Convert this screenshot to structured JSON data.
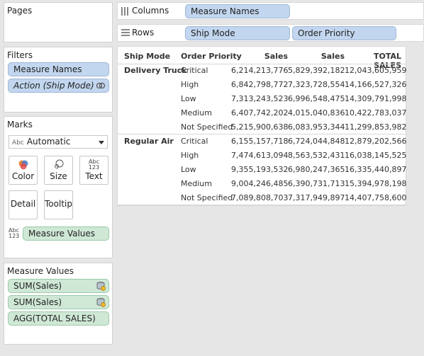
{
  "pages": {
    "title": "Pages"
  },
  "filters": {
    "title": "Filters",
    "items": [
      "Measure Names",
      "Action (Ship Mode)"
    ]
  },
  "marks": {
    "title": "Marks",
    "type_prefix": "Abc",
    "type_value": "Automatic",
    "buttons": {
      "color": "Color",
      "size": "Size",
      "text": "Text",
      "detail": "Detail",
      "tooltip": "Tooltip"
    },
    "text_icon_top": "Abc",
    "text_icon_bottom": "123",
    "measure_pill": "Measure Values"
  },
  "measure_values": {
    "title": "Measure Values",
    "items": [
      "SUM(Sales)",
      "SUM(Sales)",
      "AGG(TOTAL SALES)"
    ]
  },
  "columns_shelf": {
    "label": "Columns",
    "pills": [
      "Measure Names"
    ]
  },
  "rows_shelf": {
    "label": "Rows",
    "pills": [
      "Ship Mode",
      "Order Priority"
    ]
  },
  "table": {
    "headers": [
      "Ship Mode",
      "Order Priority",
      "Sales",
      "Sales",
      "TOTAL SALES"
    ],
    "groups": [
      {
        "ship_mode": "Delivery Truck",
        "rows": [
          {
            "priority": "Critical",
            "sales1": "6,214,213,776",
            "sales2": "5,829,392,182",
            "total": "12,043,605,959"
          },
          {
            "priority": "High",
            "sales1": "6,842,798,772",
            "sales2": "7,323,728,554",
            "total": "14,166,527,326"
          },
          {
            "priority": "Low",
            "sales1": "7,313,243,523",
            "sales2": "6,996,548,475",
            "total": "14,309,791,998"
          },
          {
            "priority": "Medium",
            "sales1": "6,407,742,202",
            "sales2": "4,015,040,836",
            "total": "10,422,783,037"
          },
          {
            "priority": "Not Specified",
            "sales1": "5,215,900,638",
            "sales2": "6,083,953,344",
            "total": "11,299,853,982"
          }
        ]
      },
      {
        "ship_mode": "Regular Air",
        "rows": [
          {
            "priority": "Critical",
            "sales1": "6,155,157,718",
            "sales2": "6,724,044,848",
            "total": "12,879,202,566"
          },
          {
            "priority": "High",
            "sales1": "7,474,613,094",
            "sales2": "8,563,532,431",
            "total": "16,038,145,525"
          },
          {
            "priority": "Low",
            "sales1": "9,355,193,532",
            "sales2": "6,980,247,365",
            "total": "16,335,440,897"
          },
          {
            "priority": "Medium",
            "sales1": "9,004,246,485",
            "sales2": "6,390,731,713",
            "total": "15,394,978,198"
          },
          {
            "priority": "Not Specified",
            "sales1": "7,089,808,703",
            "sales2": "7,317,949,897",
            "total": "14,407,758,600"
          }
        ]
      }
    ]
  }
}
